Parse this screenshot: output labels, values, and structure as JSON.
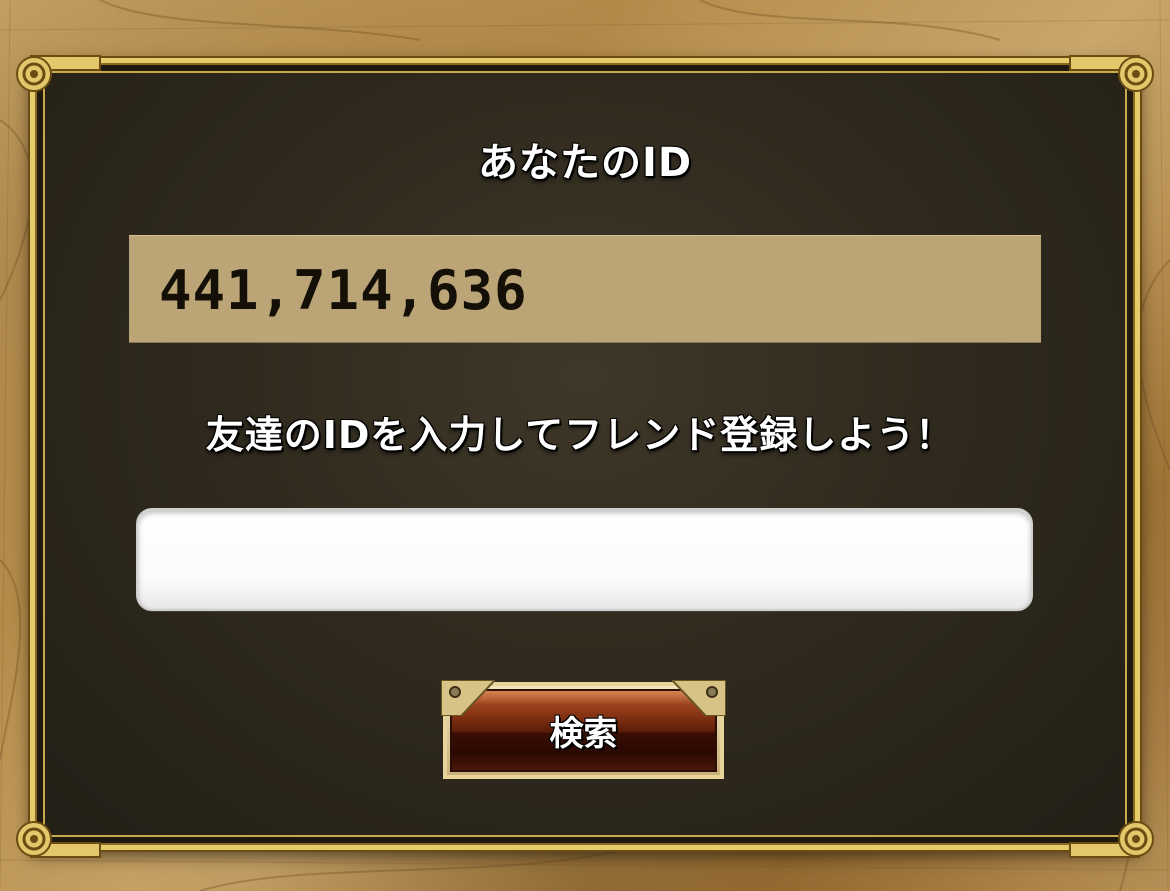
{
  "dialog": {
    "title": "あなたのID",
    "player_id": "441,714,636",
    "prompt": "友達のIDを入力してフレンド登録しよう！",
    "friend_id_input": {
      "value": "",
      "placeholder": ""
    },
    "search_button_label": "検索"
  },
  "colors": {
    "frame_gold": "#e6cb6a",
    "panel_dark": "#302a1e",
    "id_box": "#bba577",
    "button_brown": "#8a3616",
    "map_parchment": "#c9a567"
  },
  "icons": {
    "corner_ornament": "scroll-corner-icon",
    "button_rivet": "rivet-icon"
  }
}
